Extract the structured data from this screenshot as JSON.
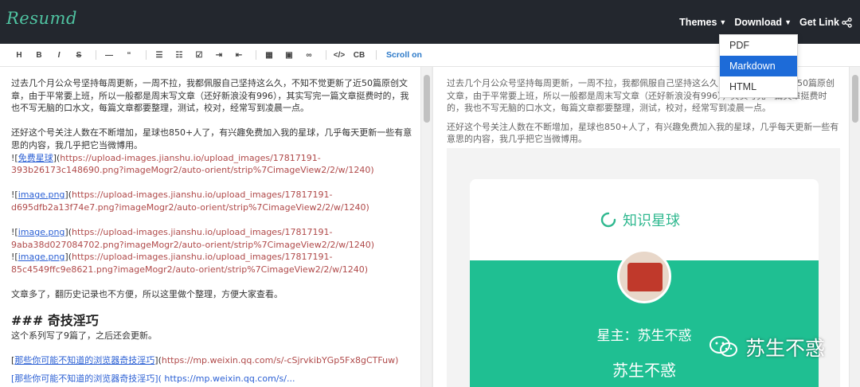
{
  "app": {
    "logo": "Resumd"
  },
  "nav": {
    "themes": "Themes",
    "download": "Download",
    "get_link": "Get Link"
  },
  "toolbar": {
    "buttons": [
      "H",
      "B",
      "I",
      "S",
      "—",
      "“",
      "☰",
      "☷",
      "☑",
      "⇥",
      "⇤",
      "▦",
      "▣",
      "∞",
      "</>",
      "CB"
    ],
    "scroll_label": "Scroll on"
  },
  "download_menu": {
    "items": [
      "PDF",
      "Markdown",
      "HTML"
    ],
    "active_index": 1
  },
  "editor": {
    "p1": "过去几个月公众号坚持每周更新，一周不拉，我都佩服自己坚持这么久，不知不觉更新了近50篇原创文章，由于平常要上班，所以一般都是周末写文章（还好新浪没有996），其实写完一篇文章挺费时的，我也不写无脑的口水文，每篇文章都要整理，测试，校对，经常写到凌晨一点。",
    "p2": "还好这个号关注人数在不断增加，星球也850+人了，有兴趣免费加入我的星球，几乎每天更新一些有意思的内容，我几乎把它当微博用。",
    "links": [
      {
        "prefix": "![",
        "text": "免费星球",
        "suffix": "](",
        "url": "https://upload-images.jianshu.io/upload_images/17817191-393b26173c148690.png?imageMogr2/auto-orient/strip%7CimageView2/2/w/1240)"
      },
      {
        "prefix": "![",
        "text": "image.png",
        "suffix": "](",
        "url": "https://upload-images.jianshu.io/upload_images/17817191-d695dfb2a13f74e7.png?imageMogr2/auto-orient/strip%7CimageView2/2/w/1240)"
      },
      {
        "prefix": "![",
        "text": "image.png",
        "suffix": "](",
        "url": "https://upload-images.jianshu.io/upload_images/17817191-9aba38d027084702.png?imageMogr2/auto-orient/strip%7CimageView2/2/w/1240)"
      },
      {
        "prefix": "![",
        "text": "image.png",
        "suffix": "](",
        "url": "https://upload-images.jianshu.io/upload_images/17817191-85c4549ffc9e8621.png?imageMogr2/auto-orient/strip%7CimageView2/2/w/1240)"
      }
    ],
    "p3": "文章多了，翻历史记录也不方便，所以这里做个整理，方便大家查看。",
    "heading": "### 奇技淫巧",
    "p4": "这个系列写了9篇了，之后还会更新。",
    "link5": {
      "prefix": "[",
      "text": "那些你可能不知道的浏览器奇技淫巧",
      "suffix": "](",
      "url": "https://mp.weixin.qq.com/s/-cSjrvkibYGp5Fx8gCTFuw)"
    },
    "partial_line": "[那些你可能不知道的浏览器奇技淫巧]( https://mp.weixin.qq.com/s/..."
  },
  "preview": {
    "p1": "过去几个月公众号坚持每周更新，一周不拉，我都佩服自己坚持这么久，不知不觉更新了近50篇原创文章，由于平常要上班，所以一般都是周末写文章（还好新浪没有996），其实写完一篇文章挺费时的，我也不写无脑的口水文，每篇文章都要整理，测试，校对，经常写到凌晨一点。",
    "p2": "还好这个号关注人数在不断增加，星球也850+人了，有兴趣免费加入我的星球，几乎每天更新一些有意思的内容，我几乎把它当微博用。",
    "card_title": "知识星球",
    "owner": "星主：苏生不惑",
    "name": "苏生不惑"
  },
  "watermark": {
    "text": "苏生不惑"
  },
  "colors": {
    "topbar": "#23272e",
    "logo": "#4fc3a1",
    "accent_green": "#1fbf92",
    "dropdown_active": "#1d6bd8",
    "link_blue": "#2a5fd4",
    "url_red": "#b04a4a"
  }
}
